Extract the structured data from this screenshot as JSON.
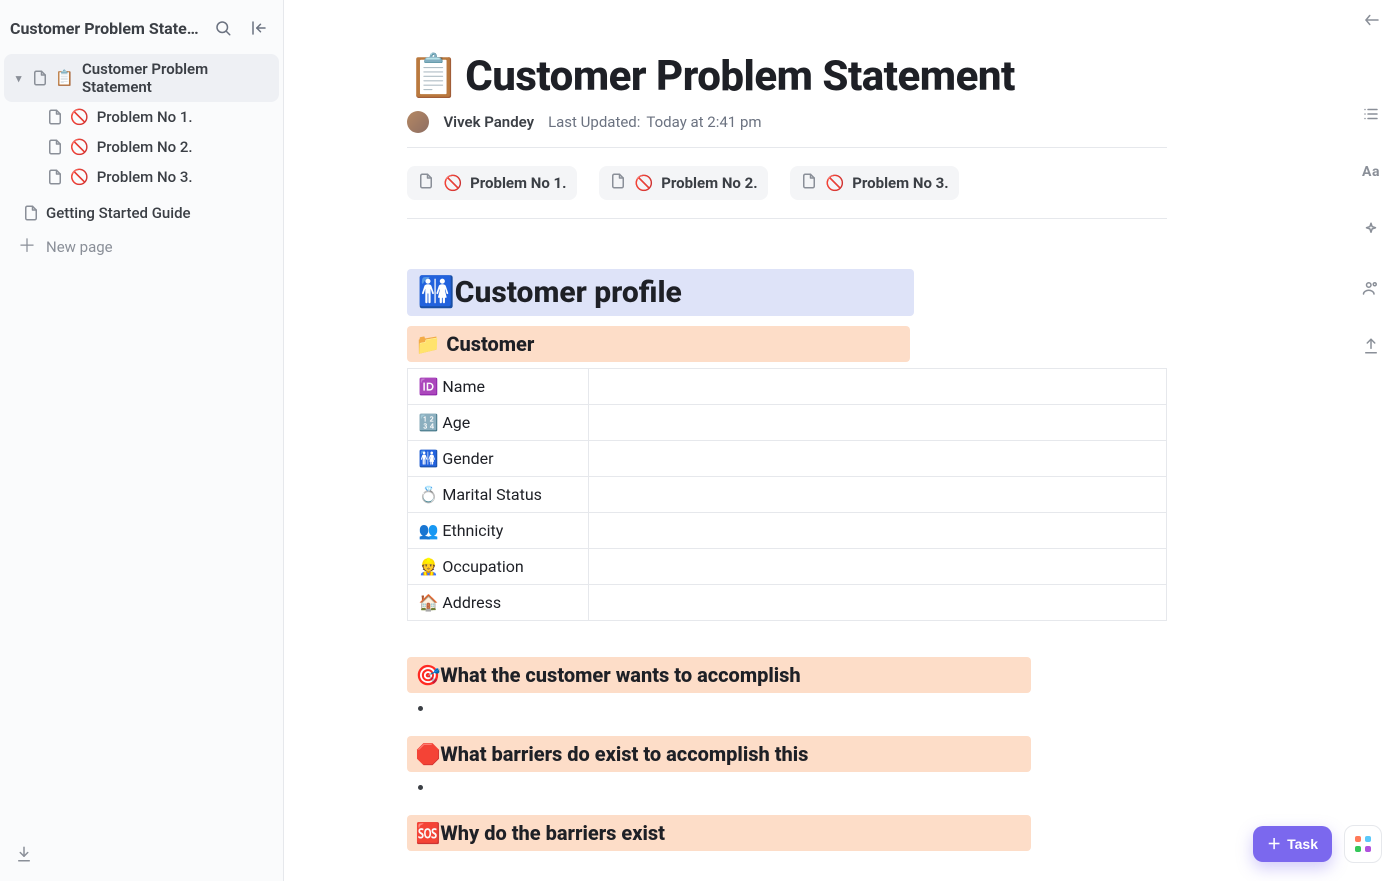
{
  "sidebar": {
    "workspace_title": "Customer Problem Statement",
    "tree": {
      "root": {
        "emoji": "📋",
        "label": "Customer Problem Statement"
      },
      "children": [
        {
          "emoji": "🚫",
          "label": "Problem No 1."
        },
        {
          "emoji": "🚫",
          "label": "Problem No 2."
        },
        {
          "emoji": "🚫",
          "label": "Problem No 3."
        }
      ]
    },
    "other_pages": [
      {
        "label": "Getting Started Guide"
      }
    ],
    "new_page_label": "New page"
  },
  "page": {
    "title_emoji": "📋",
    "title": "Customer Problem Statement",
    "author": "Vivek Pandey",
    "updated_label": "Last Updated:",
    "updated_value": "Today at 2:41 pm",
    "chips": [
      {
        "emoji": "🚫",
        "label": "Problem No 1."
      },
      {
        "emoji": "🚫",
        "label": "Problem No 2."
      },
      {
        "emoji": "🚫",
        "label": "Problem No 3."
      }
    ],
    "sections": {
      "profile_h2": {
        "emoji": "🚻",
        "text": "Customer profile"
      },
      "customer_h3": {
        "emoji": "📁",
        "text": "Customer"
      },
      "profile_rows": [
        {
          "emoji": "🆔",
          "label": "Name",
          "value": ""
        },
        {
          "emoji": "🔢",
          "label": "Age",
          "value": ""
        },
        {
          "emoji": "🚻",
          "label": "Gender",
          "value": ""
        },
        {
          "emoji": "💍",
          "label": "Marital Status",
          "value": ""
        },
        {
          "emoji": "👥",
          "label": "Ethnicity",
          "value": ""
        },
        {
          "emoji": "👷",
          "label": "Occupation",
          "value": ""
        },
        {
          "emoji": "🏠",
          "label": "Address",
          "value": ""
        }
      ],
      "wants": {
        "emoji": "🎯",
        "text": "What the customer wants to accomplish"
      },
      "barriers": {
        "emoji": "🛑",
        "text": "What barriers do exist to accomplish this"
      },
      "why": {
        "emoji": "🆘",
        "text": "Why do the barriers exist"
      }
    }
  },
  "rail": {
    "outline": "Outline",
    "aa": "Aa"
  },
  "actions": {
    "task": "Task"
  }
}
